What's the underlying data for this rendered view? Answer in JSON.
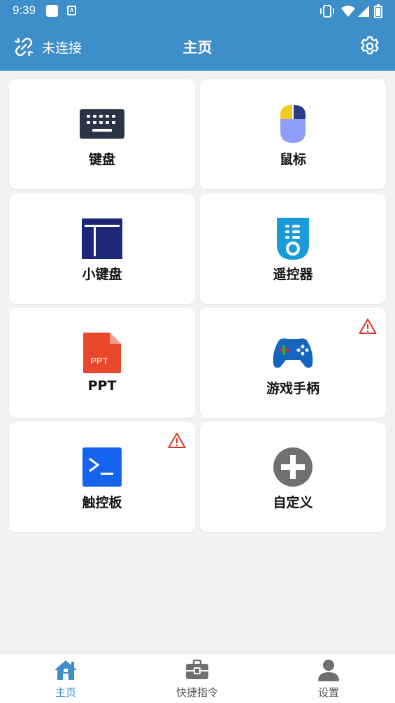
{
  "status_bar": {
    "time": "9:39"
  },
  "header": {
    "connection_label": "未连接",
    "title": "主页",
    "bg_color": "#3d8ec9"
  },
  "cards": [
    {
      "label": "键盘",
      "icon": "keyboard-icon",
      "warning": false
    },
    {
      "label": "鼠标",
      "icon": "mouse-icon",
      "warning": false
    },
    {
      "label": "小键盘",
      "icon": "numpad-icon",
      "warning": false
    },
    {
      "label": "遥控器",
      "icon": "remote-icon",
      "warning": false
    },
    {
      "label": "PPT",
      "icon": "ppt-icon",
      "icon_text": "PPT",
      "warning": false
    },
    {
      "label": "游戏手柄",
      "icon": "gamepad-icon",
      "warning": true
    },
    {
      "label": "触控板",
      "icon": "terminal-icon",
      "warning": true
    },
    {
      "label": "自定义",
      "icon": "add-icon",
      "warning": false
    }
  ],
  "bottom_nav": [
    {
      "label": "主页",
      "icon": "home-icon",
      "active": true
    },
    {
      "label": "快捷指令",
      "icon": "toolbox-icon",
      "active": false
    },
    {
      "label": "设置",
      "icon": "person-icon",
      "active": false
    }
  ],
  "colors": {
    "accent": "#3d8ec9",
    "warning": "#d9342b",
    "ppt": "#e8472c",
    "terminal": "#1464f0"
  }
}
